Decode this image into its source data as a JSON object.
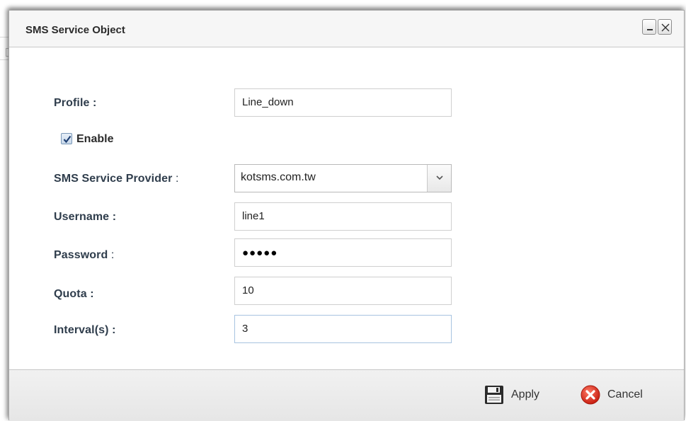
{
  "dialog": {
    "title": "SMS Service Object",
    "minimize_icon": "minimize-icon",
    "close_icon": "close-icon"
  },
  "form": {
    "profile": {
      "label": "Profile",
      "colon": " :",
      "value": "Line_down"
    },
    "enable": {
      "label": "Enable",
      "checked": true
    },
    "provider": {
      "label": "SMS Service Provider",
      "colon": " :",
      "value": "kotsms.com.tw"
    },
    "username": {
      "label": "Username",
      "colon": " :",
      "value": "line1"
    },
    "password": {
      "label": "Password",
      "colon": " :",
      "value": "●●●●●"
    },
    "quota": {
      "label": "Quota",
      "colon": " :",
      "value": "10"
    },
    "interval": {
      "label": "Interval(s)",
      "colon": " :",
      "value": "3"
    }
  },
  "footer": {
    "apply_label": "Apply",
    "cancel_label": "Cancel",
    "apply_icon": "floppy-disk-icon",
    "cancel_icon": "cancel-x-icon"
  },
  "colors": {
    "label_text": "#2f3d4c",
    "cancel_red": "#e0301e",
    "checkbox_blue": "#7a98b8"
  }
}
